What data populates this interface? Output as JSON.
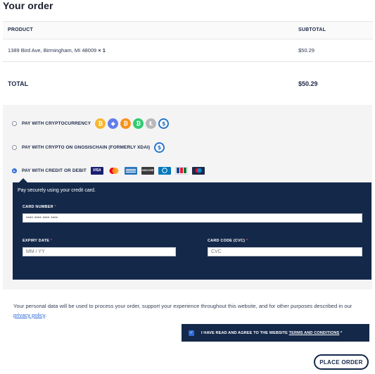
{
  "heading": "Your order",
  "order_table": {
    "col_product": "PRODUCT",
    "col_subtotal": "SUBTOTAL",
    "items": [
      {
        "name": "1389 Bird Ave, Birmingham, MI 48009",
        "qty": "× 1",
        "subtotal": "$50.29"
      }
    ],
    "total_label": "TOTAL",
    "total_value": "$50.29"
  },
  "payment": {
    "options": [
      {
        "label": "PAY WITH CRYPTOCURRENCY",
        "selected": false
      },
      {
        "label": "PAY WITH CRYPTO ON GNOSISCHAIN (FORMERLY XDAI)",
        "selected": false
      },
      {
        "label": "PAY WITH CREDIT OR DEBIT",
        "selected": true
      }
    ],
    "crypto_icons": [
      "bitcoin-cash-icon",
      "ethereum-icon",
      "bitcoin-icon",
      "bitcoin-cash-green-icon",
      "litecoin-icon",
      "usdc-icon"
    ],
    "gnosis_icons": [
      "usdc-icon"
    ],
    "card_logos": [
      "visa-icon",
      "mastercard-icon",
      "amex-icon",
      "discover-icon",
      "diners-icon",
      "jcb-icon",
      "maestro-icon"
    ],
    "card_logo_text": {
      "visa": "VISA",
      "discover": "DISCOVER"
    },
    "colors": {
      "panel": "#14284a",
      "accent": "#2f6bd6",
      "required": "#e25555"
    },
    "card_form": {
      "intro": "Pay securely using your credit card.",
      "card_number_label": "CARD NUMBER",
      "card_number_placeholder": "•••• •••• •••• ••••",
      "expiry_label": "EXPIRY DATE",
      "expiry_placeholder": "MM / YY",
      "cvc_label": "CARD CODE (CVC)",
      "cvc_placeholder": "CVC",
      "required_mark": "*"
    }
  },
  "privacy": {
    "text_before": "Your personal data will be used to process your order, support your experience throughout this website, and for other purposes described in our ",
    "link": "privacy policy",
    "text_after": "."
  },
  "terms": {
    "text": "I HAVE READ AND AGREE TO THE WEBSITE ",
    "link": "TERMS AND CONDITIONS",
    "required_mark": "*",
    "checked": true
  },
  "place_order_label": "PLACE ORDER"
}
